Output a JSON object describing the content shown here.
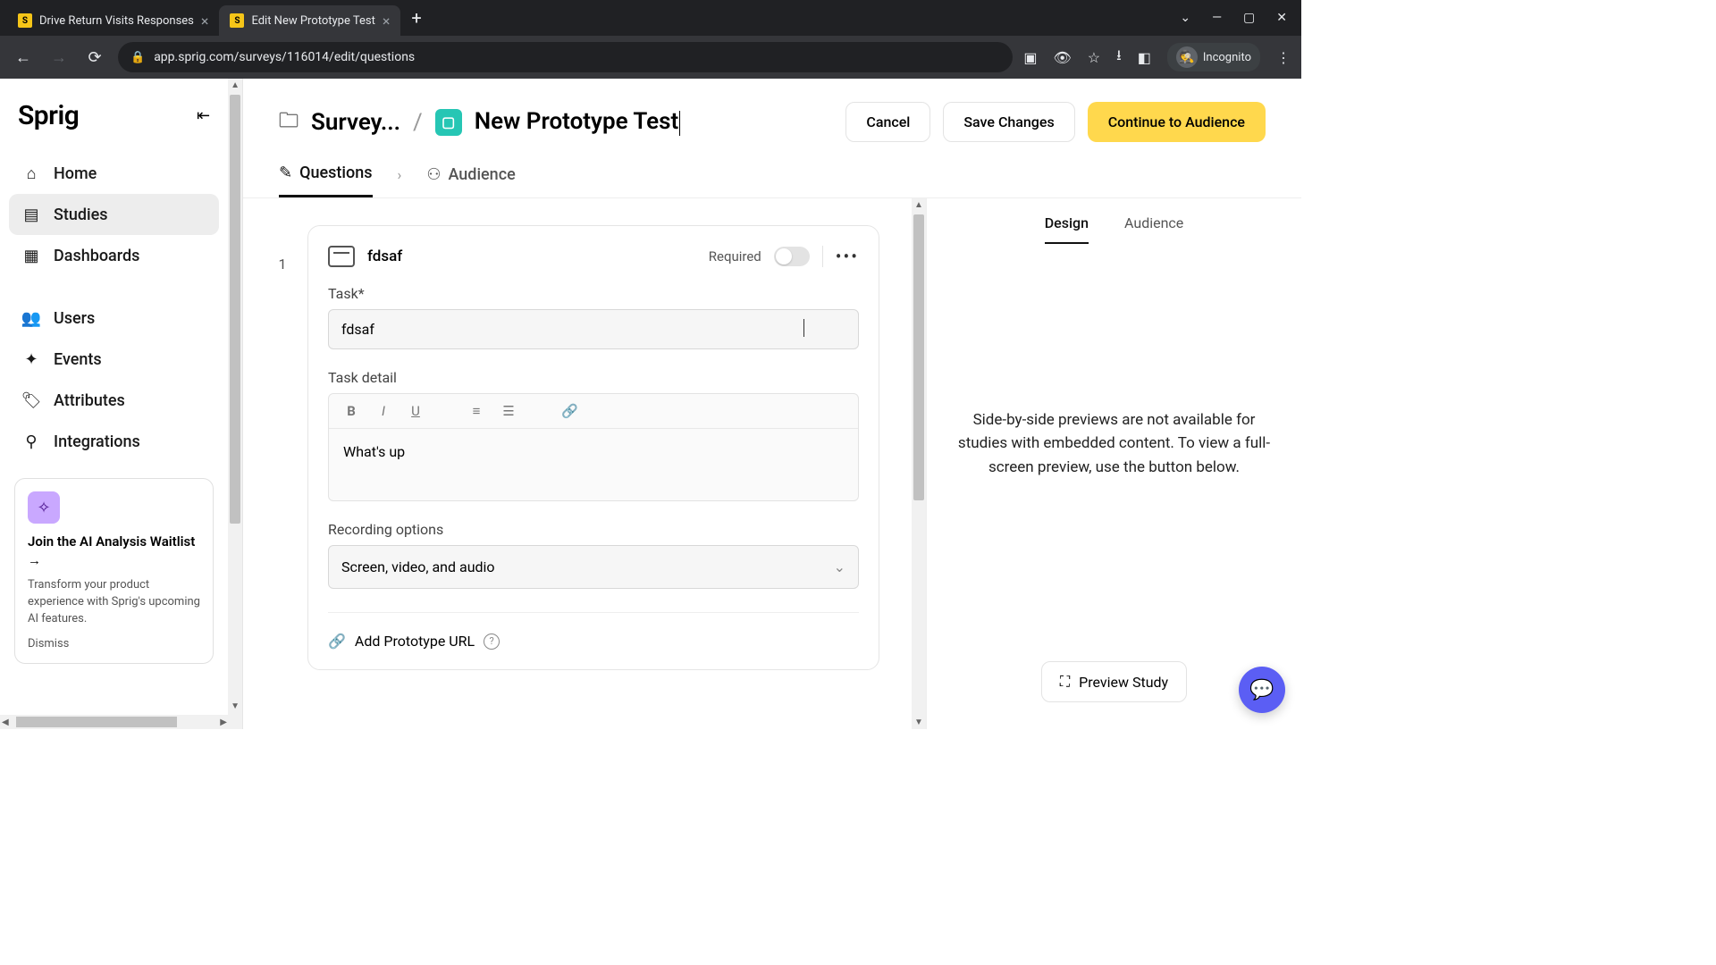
{
  "browser": {
    "tabs": [
      {
        "title": "Drive Return Visits Responses",
        "active": false
      },
      {
        "title": "Edit New Prototype Test",
        "active": true
      }
    ],
    "url": "app.sprig.com/surveys/116014/edit/questions",
    "incognito_label": "Incognito"
  },
  "brand": "Sprig",
  "nav": {
    "primary": [
      {
        "label": "Home",
        "icon": "home"
      },
      {
        "label": "Studies",
        "icon": "studies",
        "active": true
      },
      {
        "label": "Dashboards",
        "icon": "dashboards"
      }
    ],
    "secondary": [
      {
        "label": "Users",
        "icon": "users"
      },
      {
        "label": "Events",
        "icon": "events"
      },
      {
        "label": "Attributes",
        "icon": "attributes"
      },
      {
        "label": "Integrations",
        "icon": "integrations"
      }
    ]
  },
  "ai_card": {
    "title": "Join the AI Analysis Waitlist →",
    "body": "Transform your product experience with Sprig's upcoming AI features.",
    "dismiss": "Dismiss"
  },
  "header": {
    "breadcrumb_root": "Survey...",
    "title": "New Prototype Test",
    "cancel": "Cancel",
    "save": "Save Changes",
    "continue": "Continue to Audience"
  },
  "main_tabs": {
    "questions": "Questions",
    "audience": "Audience"
  },
  "question": {
    "number": "1",
    "title": "fdsaf",
    "required_label": "Required",
    "task_label": "Task*",
    "task_value": "fdsaf",
    "detail_label": "Task detail",
    "detail_value": "What's up",
    "recording_label": "Recording options",
    "recording_value": "Screen, video, and audio",
    "add_proto": "Add Prototype URL"
  },
  "preview": {
    "tabs": {
      "design": "Design",
      "audience": "Audience"
    },
    "message": "Side-by-side previews are not available for studies with embedded content. To view a full-screen preview, use the button below.",
    "button": "Preview Study"
  }
}
